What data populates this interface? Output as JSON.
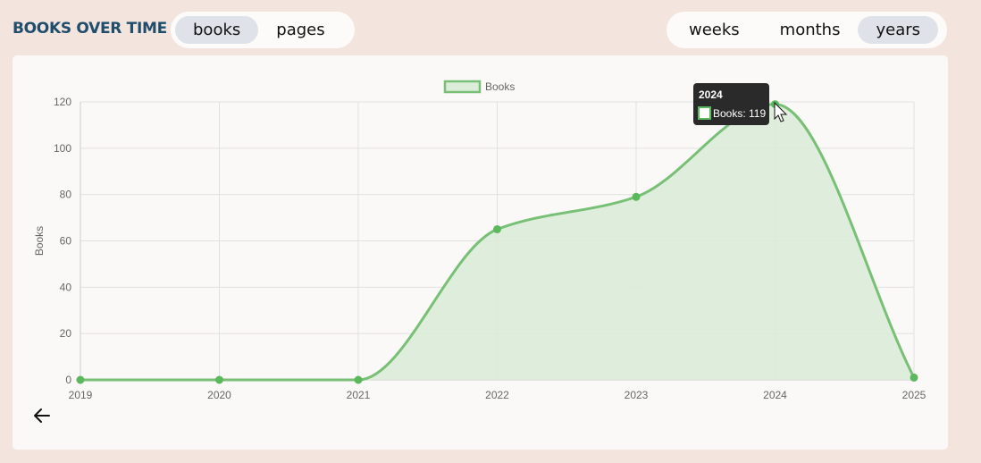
{
  "header": {
    "title": "BOOKS OVER TIME",
    "metric_tabs": [
      {
        "label": "books",
        "active": true
      },
      {
        "label": "pages",
        "active": false
      }
    ],
    "period_tabs": [
      {
        "label": "weeks",
        "active": false
      },
      {
        "label": "months",
        "active": false
      },
      {
        "label": "years",
        "active": true
      }
    ]
  },
  "tooltip": {
    "title": "2024",
    "body": "Books: 119"
  },
  "back_button": {
    "icon": "arrow-left-icon"
  },
  "colors": {
    "line": "#77c075",
    "fill": "#dbecd8",
    "point": "#5cb85c",
    "title": "#1f4d6b"
  },
  "chart_data": {
    "type": "area",
    "categories": [
      "2019",
      "2020",
      "2021",
      "2022",
      "2023",
      "2024",
      "2025"
    ],
    "series": [
      {
        "name": "Books",
        "values": [
          0,
          0,
          0,
          65,
          79,
          119,
          1
        ]
      }
    ],
    "ylabel": "Books",
    "xlabel": "",
    "ylim": [
      0,
      120
    ],
    "yticks": [
      0,
      20,
      40,
      60,
      80,
      100,
      120
    ],
    "grid": true,
    "legend": "top-center"
  }
}
